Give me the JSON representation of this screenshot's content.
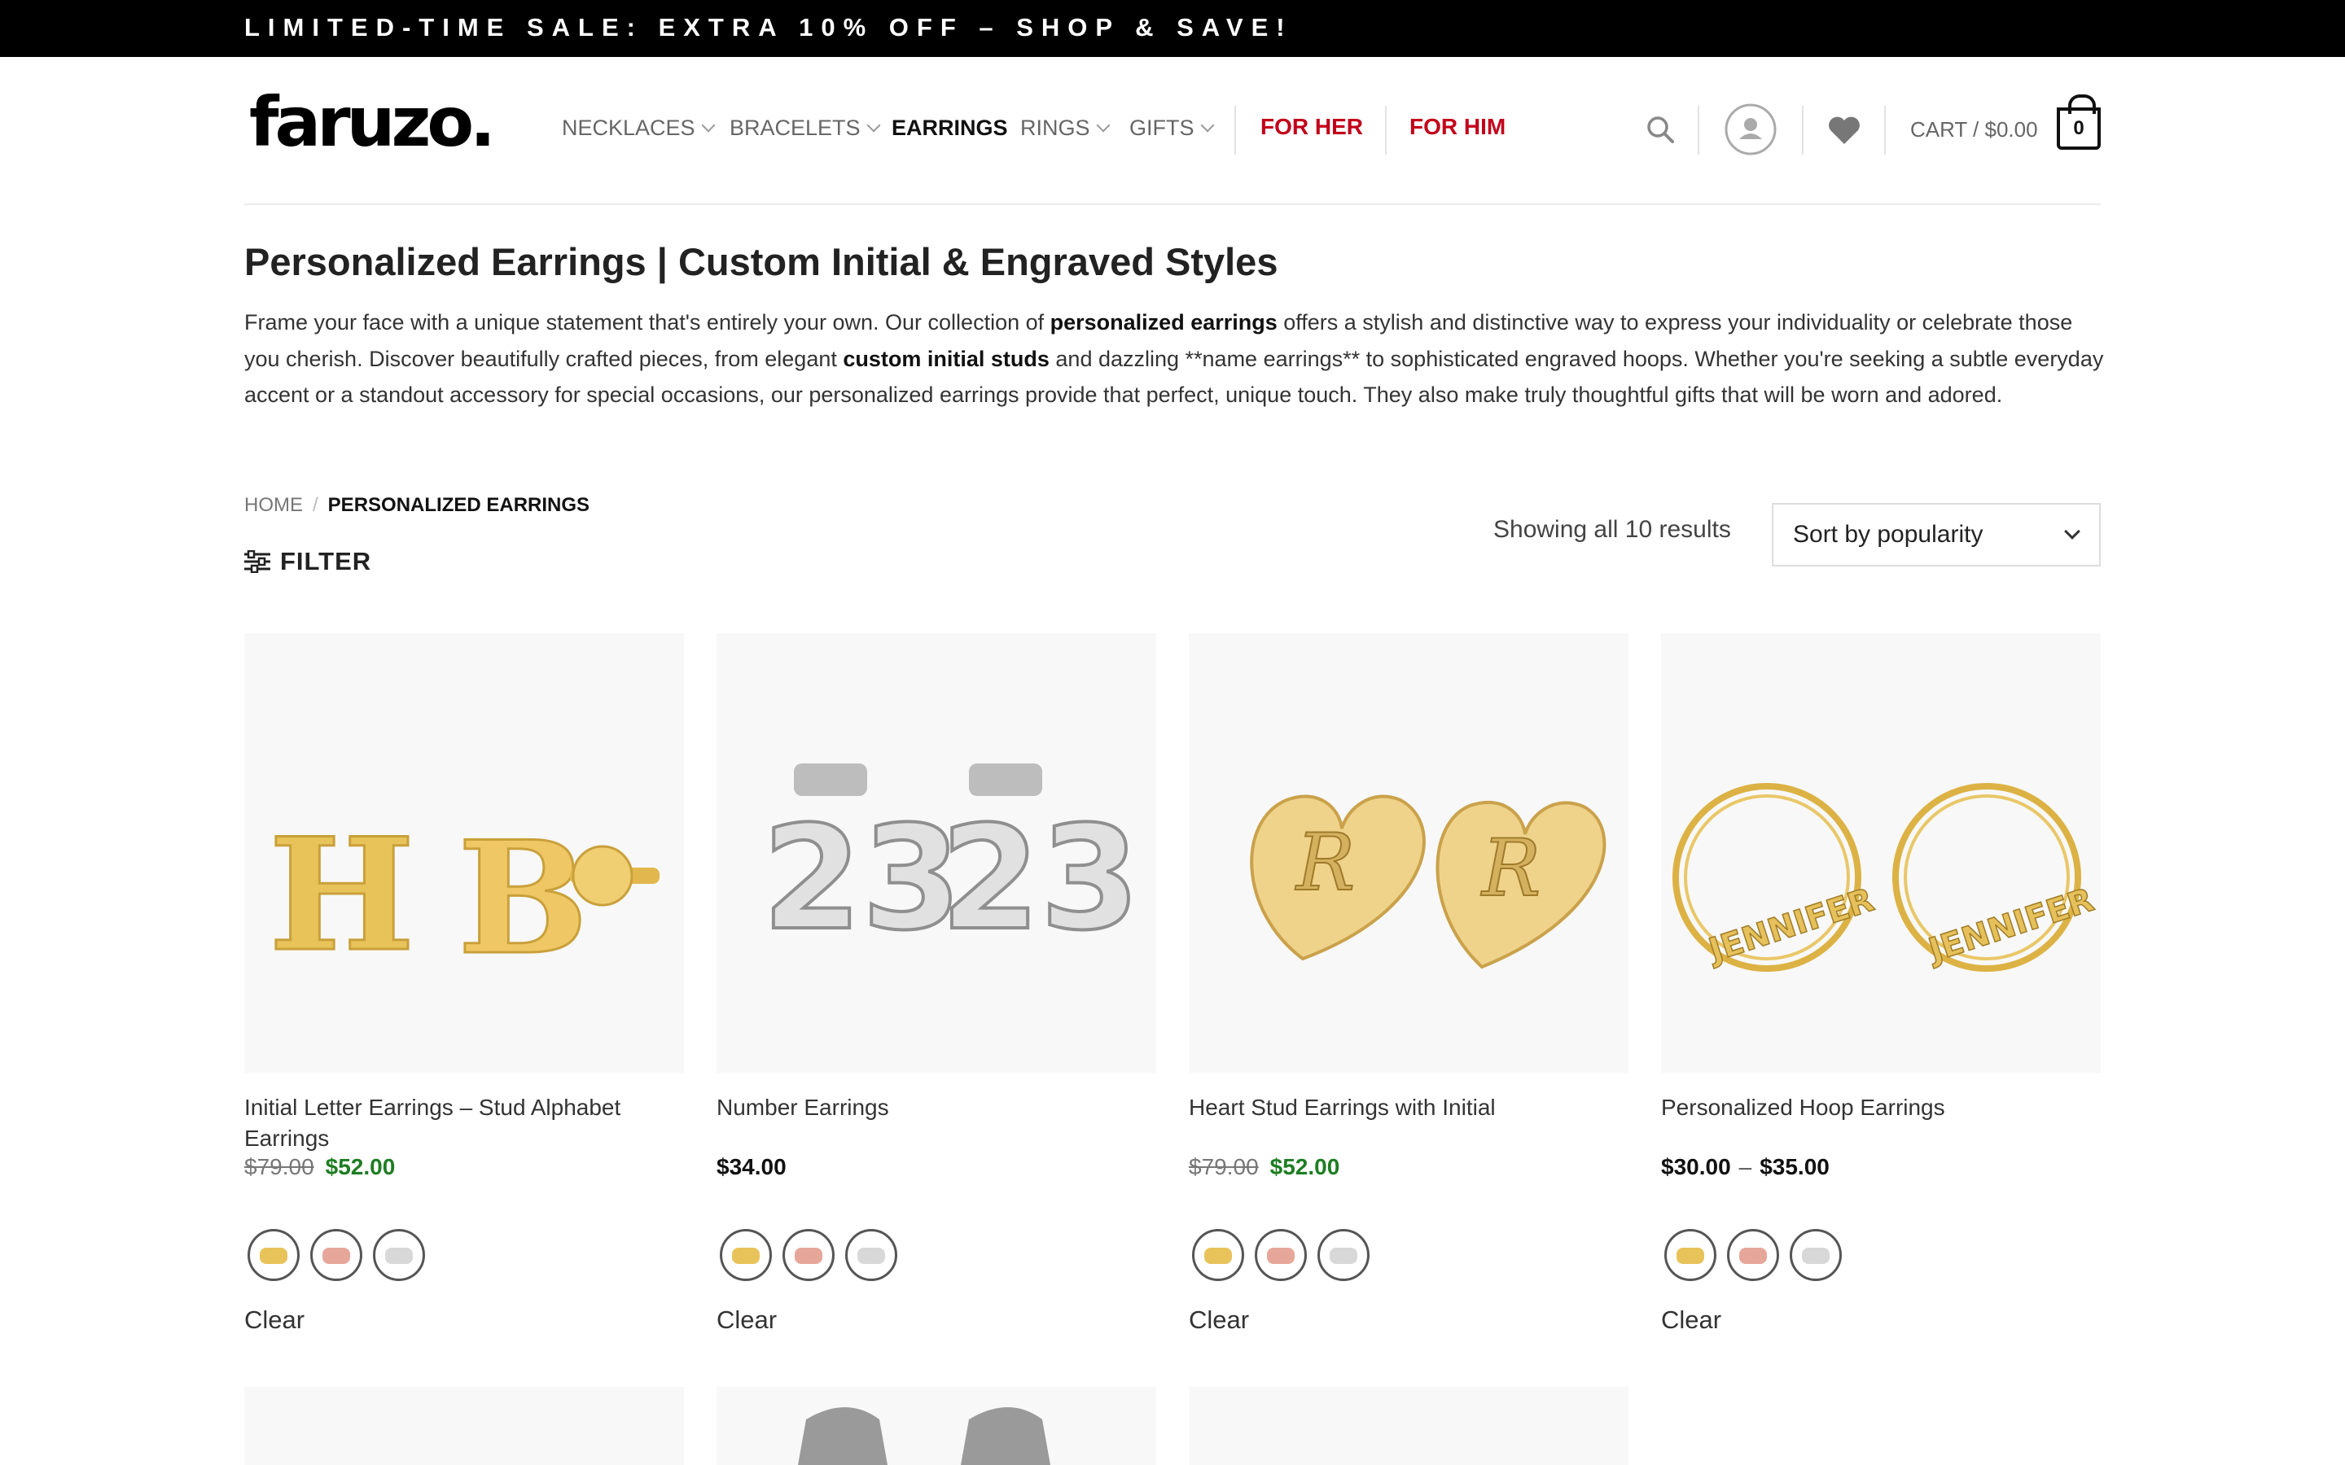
{
  "promo": {
    "text": "LIMITED-TIME SALE: EXTRA 10% OFF – SHOP & SAVE!"
  },
  "header": {
    "logo": "faruzo.",
    "nav": [
      {
        "label": "NECKLACES",
        "dropdown": true
      },
      {
        "label": "BRACELETS",
        "dropdown": true
      },
      {
        "label": "EARRINGS",
        "dropdown": false,
        "active": true
      },
      {
        "label": "RINGS",
        "dropdown": true
      },
      {
        "label": "GIFTS",
        "dropdown": true
      }
    ],
    "highlight_nav": [
      "FOR HER",
      "FOR HIM"
    ],
    "icons": [
      "search-icon",
      "account-icon",
      "wishlist-heart-icon"
    ],
    "cart_label": "CART / $0.00",
    "cart_count": "0"
  },
  "page": {
    "title": "Personalized Earrings | Custom Initial & Engraved Styles",
    "description": {
      "p1": "Frame your face with a unique statement that's entirely your own. Our collection of ",
      "b1": "personalized earrings",
      "p2": " offers a stylish and distinctive way to express your individuality or celebrate those you cherish. Discover beautifully crafted pieces, from elegant ",
      "b2": "custom initial studs",
      "p3": " and dazzling **name earrings** to sophisticated engraved hoops. Whether you're seeking a subtle everyday accent or a standout accessory for special occasions, our personalized earrings provide that perfect, unique touch. They also make truly thoughtful gifts that will be worn and adored."
    }
  },
  "breadcrumb": {
    "home": "HOME",
    "separator": "/",
    "current": "PERSONALIZED EARRINGS"
  },
  "filter_label": "FILTER",
  "results_text": "Showing all 10 results",
  "sort": {
    "selected": "Sort by popularity"
  },
  "products": [
    {
      "name": "Initial Letter Earrings – Stud Alphabet Earrings",
      "old_price": "$79.00",
      "price": "$52.00",
      "swatches": [
        "gold",
        "rose-gold",
        "silver"
      ],
      "clear": "Clear"
    },
    {
      "name": "Number Earrings",
      "price": "$34.00",
      "swatches": [
        "gold",
        "rose-gold",
        "silver"
      ],
      "clear": "Clear"
    },
    {
      "name": "Heart Stud Earrings with Initial",
      "old_price": "$79.00",
      "price": "$52.00",
      "swatches": [
        "gold",
        "rose-gold",
        "silver"
      ],
      "clear": "Clear"
    },
    {
      "name": "Personalized Hoop Earrings",
      "price_range": {
        "min": "$30.00",
        "sep": "–",
        "max": "$35.00"
      },
      "swatches": [
        "gold",
        "rose-gold",
        "silver"
      ],
      "clear": "Clear"
    }
  ],
  "colors": {
    "promo_bg": "#000000",
    "accent_red": "#c2001a",
    "sale_green": "#1e7d22",
    "gold": "#e8c35a",
    "rose_gold": "#e6a79a",
    "silver": "#d8d8d8"
  },
  "image_text": {
    "number_earring": "23",
    "heart_initial": "R",
    "letter_left": "H",
    "letter_right": "B",
    "hoop_name": "JENNIFER"
  }
}
